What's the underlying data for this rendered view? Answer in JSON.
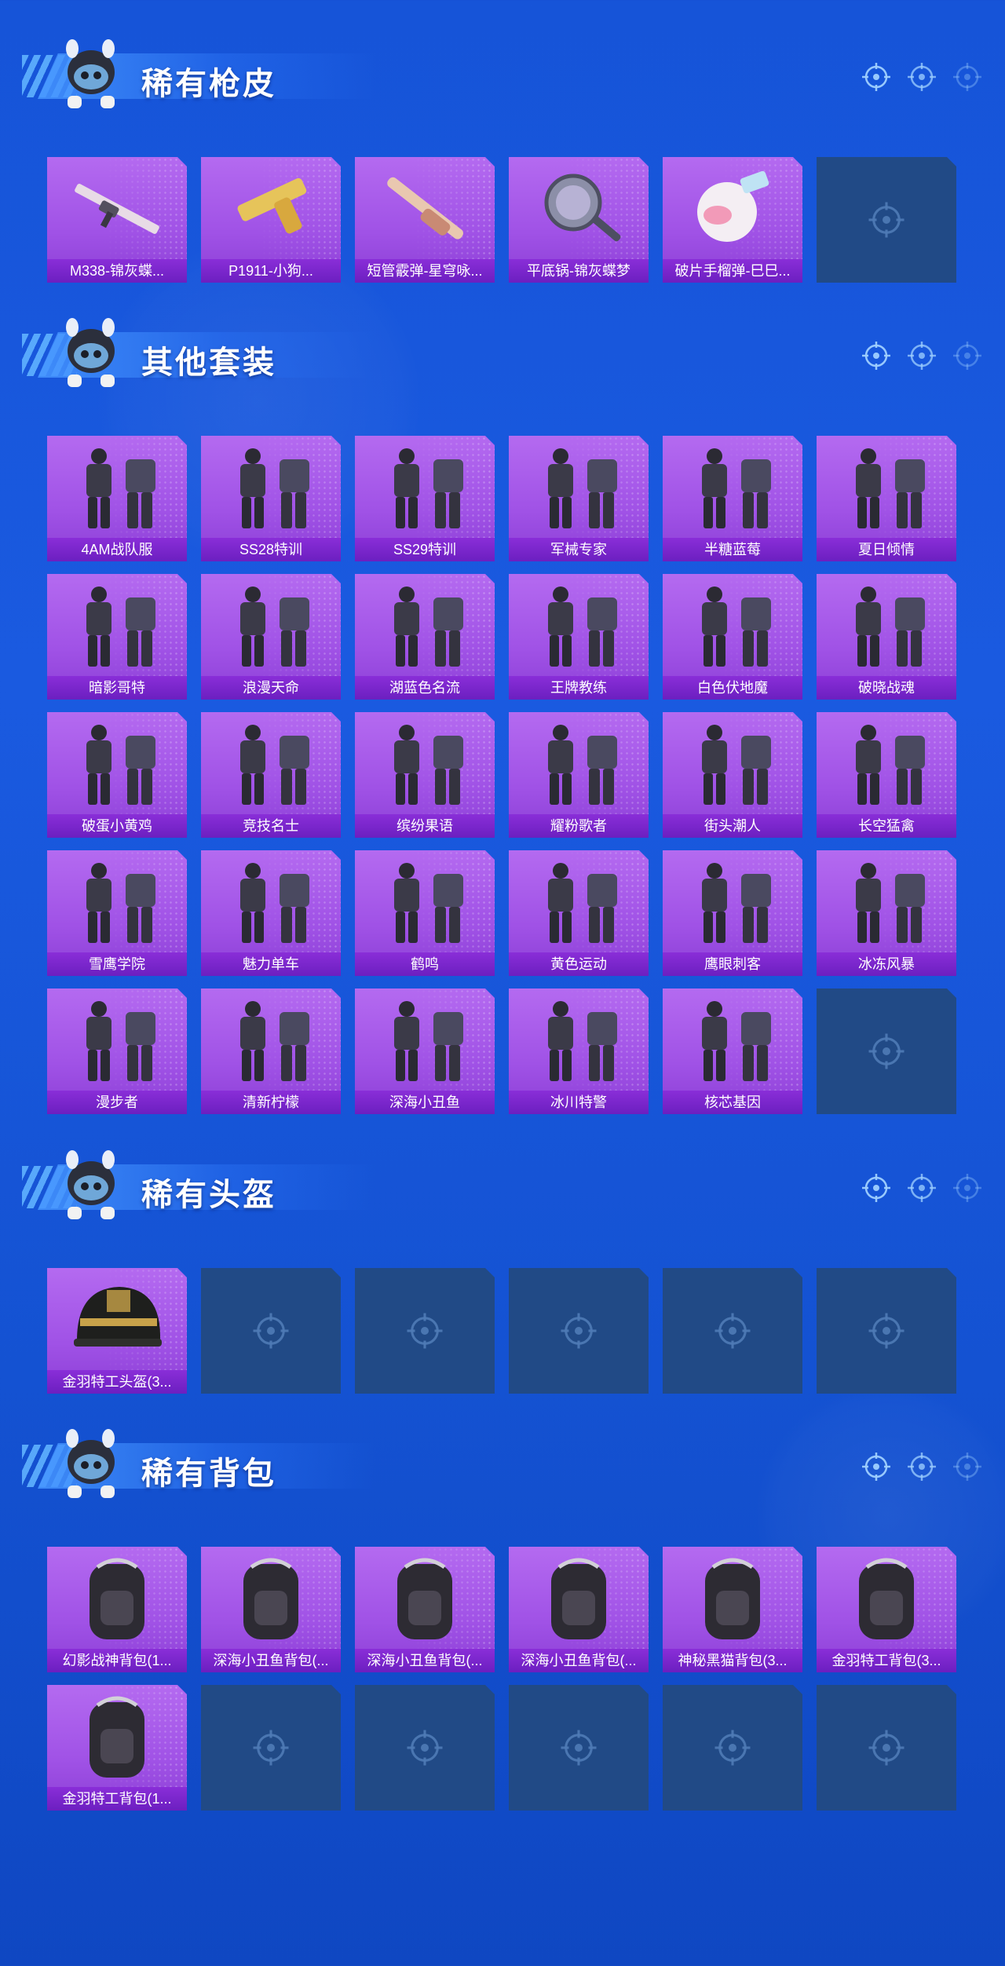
{
  "sections": [
    {
      "title": "稀有枪皮",
      "items": [
        {
          "label": "M338-锦灰蝶...",
          "icon": "rifle-icon"
        },
        {
          "label": "P1911-小狗...",
          "icon": "pistol-icon"
        },
        {
          "label": "短管霰弹-星穹咏...",
          "icon": "shotgun-icon"
        },
        {
          "label": "平底锅-锦灰蝶梦",
          "icon": "pan-icon"
        },
        {
          "label": "破片手榴弹-巳巳...",
          "icon": "grenade-icon"
        },
        {
          "label": "",
          "icon": "empty-slot-icon"
        }
      ]
    },
    {
      "title": "其他套装",
      "items": [
        {
          "label": "4AM战队服",
          "icon": "outfit-icon"
        },
        {
          "label": "SS28特训",
          "icon": "outfit-icon"
        },
        {
          "label": "SS29特训",
          "icon": "outfit-icon"
        },
        {
          "label": "军械专家",
          "icon": "outfit-icon"
        },
        {
          "label": "半糖蓝莓",
          "icon": "outfit-icon"
        },
        {
          "label": "夏日倾情",
          "icon": "outfit-icon"
        },
        {
          "label": "暗影哥特",
          "icon": "outfit-icon"
        },
        {
          "label": "浪漫天命",
          "icon": "outfit-icon"
        },
        {
          "label": "湖蓝色名流",
          "icon": "outfit-icon"
        },
        {
          "label": "王牌教练",
          "icon": "outfit-icon"
        },
        {
          "label": "白色伏地魔",
          "icon": "outfit-icon"
        },
        {
          "label": "破晓战魂",
          "icon": "outfit-icon"
        },
        {
          "label": "破蛋小黄鸡",
          "icon": "outfit-icon"
        },
        {
          "label": "竞技名士",
          "icon": "outfit-icon"
        },
        {
          "label": "缤纷果语",
          "icon": "outfit-icon"
        },
        {
          "label": "耀粉歌者",
          "icon": "outfit-icon"
        },
        {
          "label": "街头潮人",
          "icon": "outfit-icon"
        },
        {
          "label": "长空猛禽",
          "icon": "outfit-icon"
        },
        {
          "label": "雪鹰学院",
          "icon": "outfit-icon"
        },
        {
          "label": "魅力单车",
          "icon": "outfit-icon"
        },
        {
          "label": "鹤鸣",
          "icon": "outfit-icon"
        },
        {
          "label": "黄色运动",
          "icon": "outfit-icon"
        },
        {
          "label": "鹰眼刺客",
          "icon": "outfit-icon"
        },
        {
          "label": "冰冻风暴",
          "icon": "outfit-icon"
        },
        {
          "label": "漫步者",
          "icon": "outfit-icon"
        },
        {
          "label": "清新柠檬",
          "icon": "outfit-icon"
        },
        {
          "label": "深海小丑鱼",
          "icon": "outfit-icon"
        },
        {
          "label": "冰川特警",
          "icon": "outfit-icon"
        },
        {
          "label": "核芯基因",
          "icon": "outfit-icon"
        },
        {
          "label": "",
          "icon": "empty-slot-icon"
        }
      ]
    },
    {
      "title": "稀有头盔",
      "items": [
        {
          "label": "金羽特工头盔(3...",
          "icon": "helmet-icon"
        },
        {
          "label": "",
          "icon": "empty-slot-icon"
        },
        {
          "label": "",
          "icon": "empty-slot-icon"
        },
        {
          "label": "",
          "icon": "empty-slot-icon"
        },
        {
          "label": "",
          "icon": "empty-slot-icon"
        },
        {
          "label": "",
          "icon": "empty-slot-icon"
        }
      ]
    },
    {
      "title": "稀有背包",
      "items": [
        {
          "label": "幻影战神背包(1...",
          "icon": "backpack-icon"
        },
        {
          "label": "深海小丑鱼背包(...",
          "icon": "backpack-icon"
        },
        {
          "label": "深海小丑鱼背包(...",
          "icon": "backpack-icon"
        },
        {
          "label": "深海小丑鱼背包(...",
          "icon": "backpack-icon"
        },
        {
          "label": "神秘黑猫背包(3...",
          "icon": "backpack-icon"
        },
        {
          "label": "金羽特工背包(3...",
          "icon": "backpack-icon"
        },
        {
          "label": "金羽特工背包(1...",
          "icon": "backpack-icon"
        },
        {
          "label": "",
          "icon": "empty-slot-icon"
        },
        {
          "label": "",
          "icon": "empty-slot-icon"
        },
        {
          "label": "",
          "icon": "empty-slot-icon"
        },
        {
          "label": "",
          "icon": "empty-slot-icon"
        },
        {
          "label": "",
          "icon": "empty-slot-icon"
        }
      ]
    }
  ],
  "colors": {
    "background": "#1654d8",
    "card_purple": "#a052e6",
    "label_purple": "#7a26cc",
    "empty_slot": "#214a86"
  }
}
